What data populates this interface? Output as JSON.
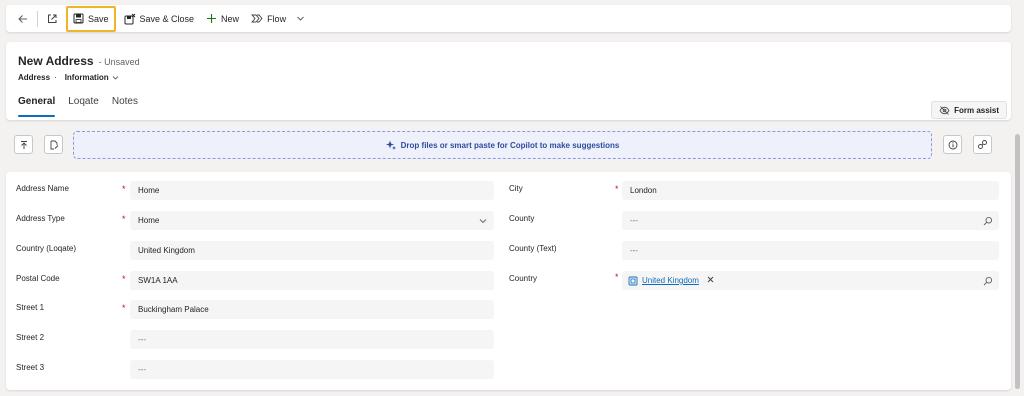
{
  "toolbar": {
    "save_label": "Save",
    "save_close_label": "Save & Close",
    "new_label": "New",
    "flow_label": "Flow"
  },
  "header": {
    "title": "New Address",
    "status": "- Unsaved",
    "entity": "Address",
    "dot": "·",
    "form_selector": "Information",
    "form_assist_label": "Form assist",
    "tabs": [
      {
        "label": "General",
        "active": true
      },
      {
        "label": "Loqate",
        "active": false
      },
      {
        "label": "Notes",
        "active": false
      }
    ]
  },
  "copilot": {
    "drop_text": "Drop files or smart paste for Copilot to make suggestions"
  },
  "form": {
    "left": [
      {
        "label": "Address Name",
        "required": true,
        "value": "Home"
      },
      {
        "label": "Address Type",
        "required": true,
        "value": "Home"
      },
      {
        "label": "Country (Loqate)",
        "required": false,
        "value": "United Kingdom"
      },
      {
        "label": "Postal Code",
        "required": true,
        "value": "SW1A 1AA"
      },
      {
        "label": "Street 1",
        "required": true,
        "value": "Buckingham Palace"
      },
      {
        "label": "Street 2",
        "required": false,
        "value": "---"
      },
      {
        "label": "Street 3",
        "required": false,
        "value": "---"
      }
    ],
    "right": [
      {
        "label": "City",
        "required": true,
        "value": "London"
      },
      {
        "label": "County",
        "required": false,
        "value": "---"
      },
      {
        "label": "County (Text)",
        "required": false,
        "value": "---"
      },
      {
        "label": "Country",
        "required": true,
        "value": "United Kingdom"
      }
    ],
    "required_mark": "*"
  },
  "icons": {
    "back": "back-arrow-icon",
    "popout": "open-in-new-window-icon",
    "save": "floppy-disk-icon",
    "save_close": "save-and-close-icon",
    "new": "plus-icon",
    "flow": "flow-icon",
    "form_assist": "eye-off-icon",
    "copilot": "sparkle-icon",
    "lookup": "search-icon",
    "dropdown": "chevron-down-icon"
  },
  "colors": {
    "accent": "#0f6cbd",
    "required": "#c50f1f",
    "save_highlight": "#f0b429",
    "copilot_text": "#2e4c9e"
  }
}
